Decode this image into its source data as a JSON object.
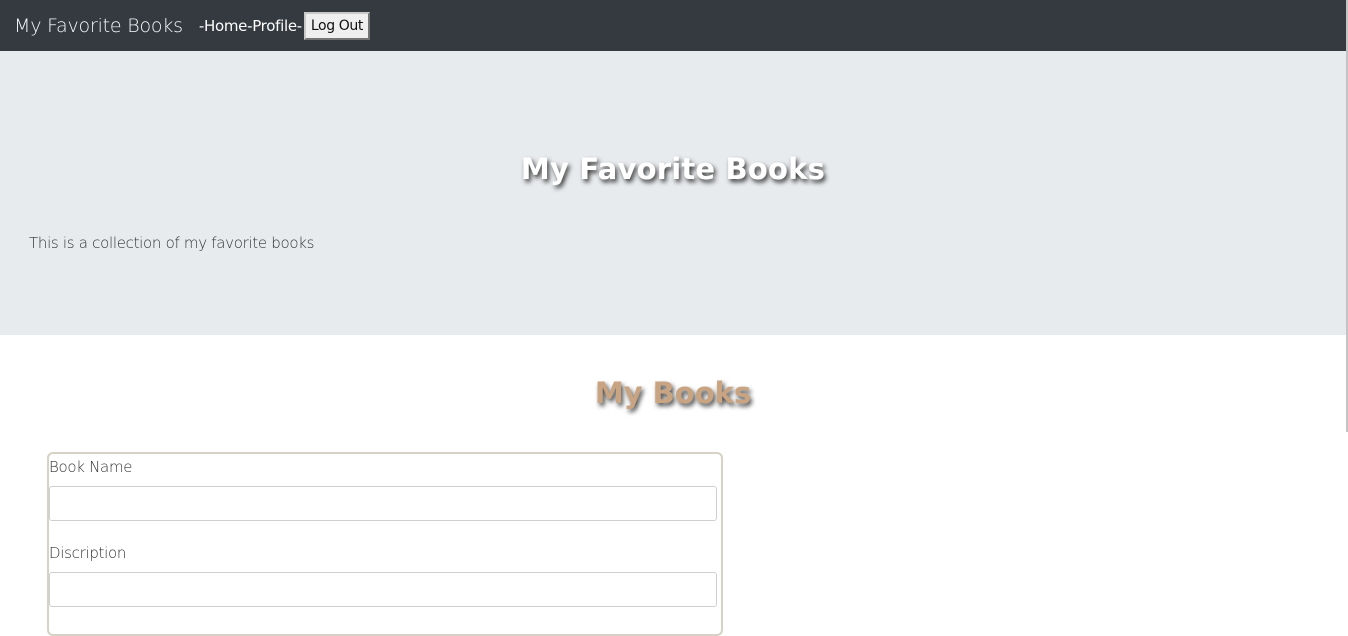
{
  "navbar": {
    "brand": "My Favorite Books",
    "sep1": "- ",
    "home": "Home",
    "sep2": "- ",
    "profile": "Profile",
    "sep3": " -",
    "logout": "Log Out"
  },
  "jumbotron": {
    "title": "My Favorite Books",
    "text": "This is a collection of my favorite books"
  },
  "main": {
    "section_title": "My Books",
    "form": {
      "book_name_label": "Book Name",
      "book_name_value": "",
      "description_label": "Discription",
      "description_value": ""
    }
  },
  "colors": {
    "navbar_bg": "#343a40",
    "jumbotron_bg": "#e8ebee",
    "section_title": "#c8a482"
  }
}
